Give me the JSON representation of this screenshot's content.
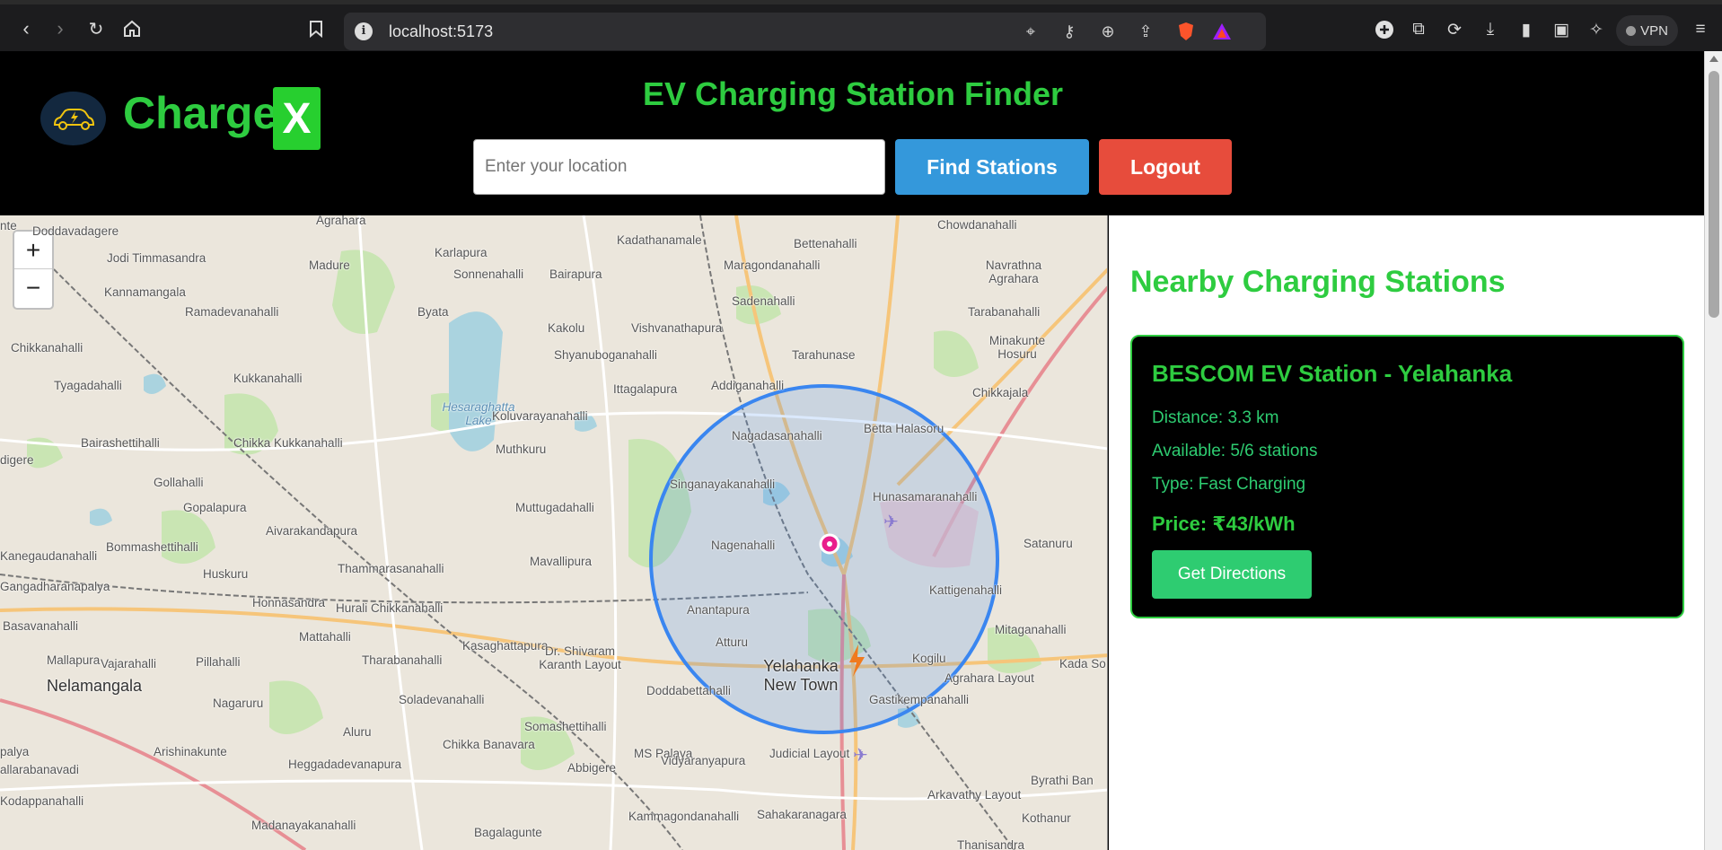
{
  "browser": {
    "url": "localhost:5173",
    "vpn_label": "VPN"
  },
  "header": {
    "brand_name": "Charge",
    "brand_x": "X",
    "title": "EV Charging Station Finder",
    "location_placeholder": "Enter your location",
    "location_value": "",
    "find_label": "Find Stations",
    "logout_label": "Logout"
  },
  "map": {
    "zoom_in": "+",
    "zoom_out": "−",
    "labels": [
      "Doddavadagere",
      "Agrahara",
      "Karlapura",
      "Kadathanamale",
      "Bettenahalli",
      "Chowdanahalli",
      "Jodi Timmasandra",
      "Madure",
      "Sonnenahalli",
      "Bairapura",
      "Maragondanahalli",
      "Navrathna Agrahara",
      "Kannamangala",
      "Ramadevanahalli",
      "Byata",
      "Kakolu",
      "Vishvanathapura",
      "Sadenahalli",
      "Tarabanahalli",
      "Chikkanahalli",
      "Shyanuboganahalli",
      "Tarahunase",
      "Minakunte Hosuru",
      "Tyagadahalli",
      "Kukkanahalli",
      "Ittagalapura",
      "Addiganahalli",
      "Hesaraghatta Lake",
      "Koluvarayanahalli",
      "Chikkajala",
      "Bairashettihalli",
      "Chikka Kukkanahalli",
      "Muthkuru",
      "Nagadasanahalli",
      "Betta Halasoru",
      "Gollahalli",
      "Singanayakanahalli",
      "Gopalapura",
      "Muttugadahalli",
      "Hunasamaranahalli",
      "Aivarakandapura",
      "Nagenahalli",
      "Satanuru",
      "Bommashettihalli",
      "Kanegaudanahalli",
      "Huskuru",
      "Thammarasanahalli",
      "Mavallipura",
      "Gangadharanapalya",
      "Honnasandra",
      "Hurali Chikkanahalli",
      "Anantapura",
      "Kattigenahalli",
      "Basavanahalli",
      "Mattahalli",
      "Kasaghattapura",
      "Atturu",
      "Mitaganahalli",
      "Mallapura",
      "Vajarahalli",
      "Pillahalli",
      "Tharabanahalli",
      "Dr. Shivaram Karanth Layout",
      "Yelahanka New Town",
      "Kogilu",
      "Agrahara Layout",
      "Kada So",
      "Nelamangala",
      "Nagaruru",
      "Soladevanahalli",
      "Doddabettahalli",
      "Gastikempanahalli",
      "Aluru",
      "Somashettihalli",
      "MS Palaya",
      "Judicial Layout",
      "Arishinakunte",
      "Chikka Banavara",
      "Vidyaranyapura",
      "Heggadadevanapura",
      "Abbigere",
      "Kodappanahalli",
      "Kammagondanahalli",
      "Sahakaranagara",
      "Arkavathy Layout",
      "Byrathi Ban",
      "Madanayakanahalli",
      "Bagalagunte",
      "Kothanur",
      "Thanisandra",
      "allarabanavadi",
      "palya",
      "digere",
      "nte"
    ]
  },
  "panel": {
    "title": "Nearby Charging Stations",
    "stations": [
      {
        "name": "BESCOM EV Station - Yelahanka",
        "distance": "Distance: 3.3 km",
        "available": "Available: 5/6 stations",
        "type": "Type: Fast Charging",
        "price": "Price: ₹43/kWh",
        "directions_label": "Get Directions"
      }
    ]
  },
  "colors": {
    "accent_green": "#2ecc40",
    "find_blue": "#3498db",
    "logout_red": "#e74c3c",
    "radius_blue": "#3a86f0"
  }
}
